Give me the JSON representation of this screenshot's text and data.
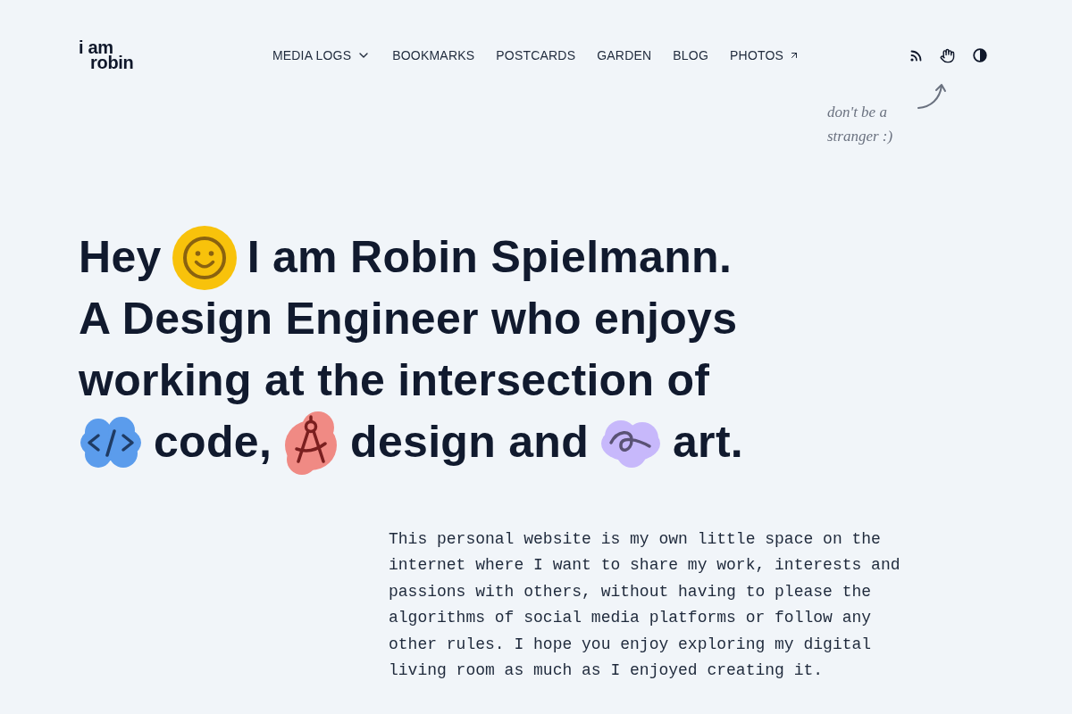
{
  "header": {
    "logo": [
      "i am",
      "robin"
    ],
    "nav": [
      {
        "label": "MEDIA LOGS",
        "kind": "menu"
      },
      {
        "label": "BOOKMARKS",
        "kind": "link"
      },
      {
        "label": "POSTCARDS",
        "kind": "link"
      },
      {
        "label": "GARDEN",
        "kind": "link"
      },
      {
        "label": "BLOG",
        "kind": "link"
      },
      {
        "label": "PHOTOS",
        "kind": "external"
      }
    ],
    "annotation": "don't be a stranger :)"
  },
  "headline": [
    "Hey",
    "I am Robin Spielmann.",
    "A Design Engineer who enjoys",
    "working at the intersection of",
    "code,",
    "design and",
    "art."
  ],
  "intro": "This personal website is my own little space on the internet where I want to share my work, interests and passions with others, without having to please the algorithms of social media platforms or follow any other rules. I hope you enjoy exploring my digital living room as much as I enjoyed creating it."
}
